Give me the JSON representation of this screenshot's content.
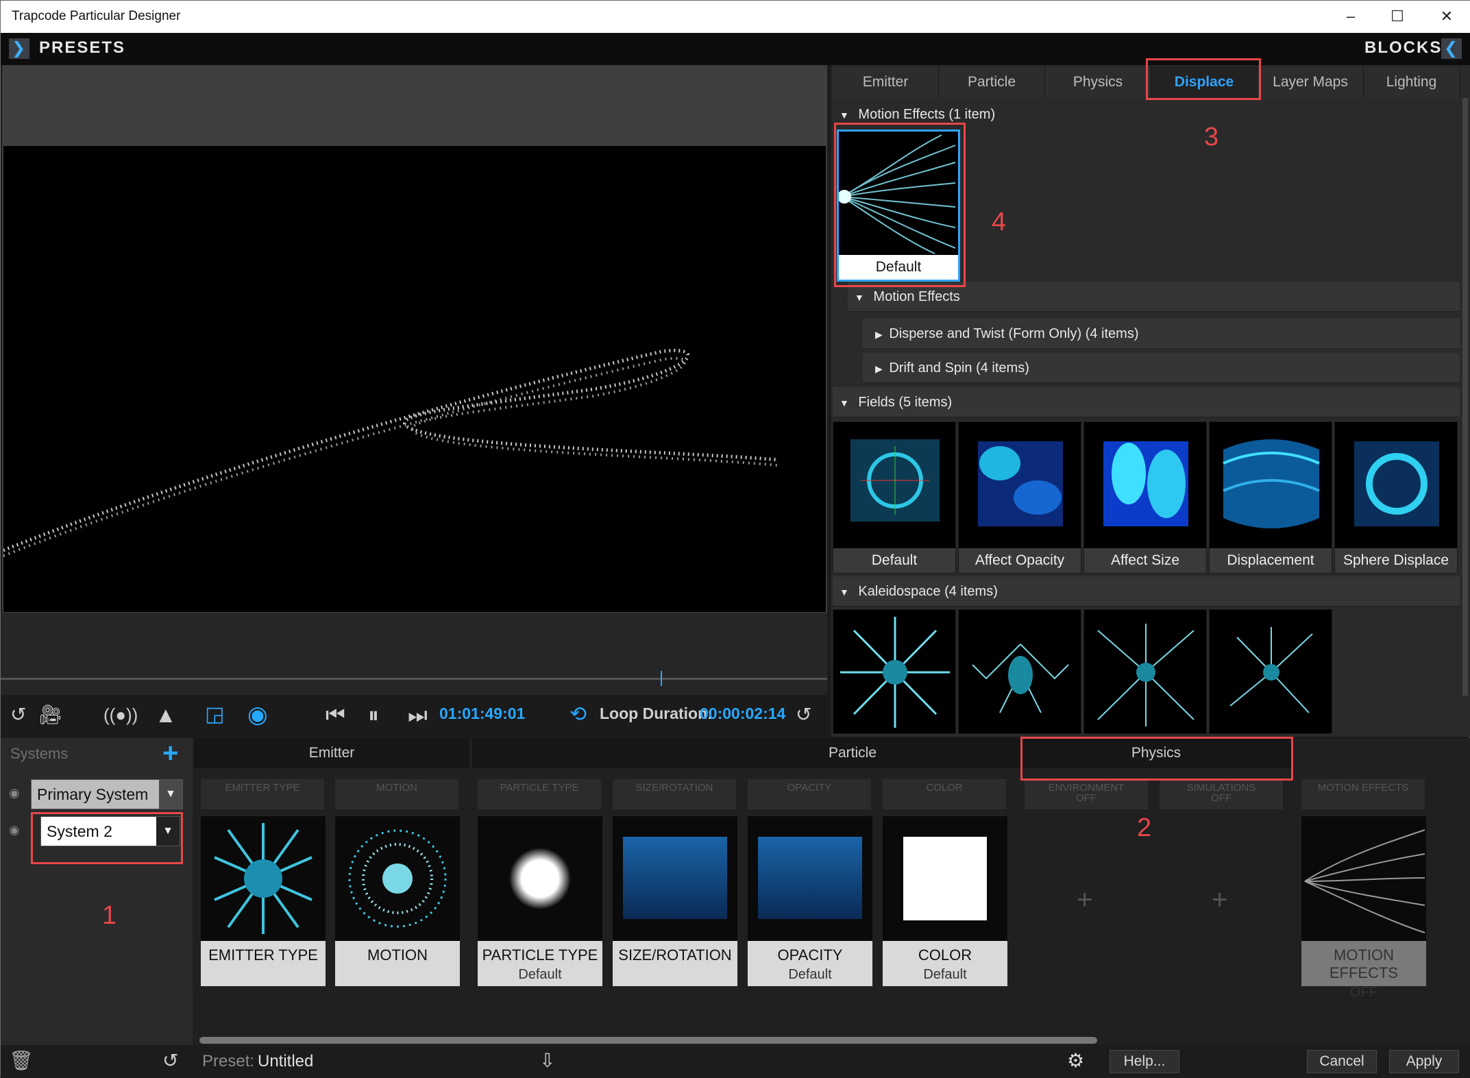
{
  "window": {
    "title": "Trapcode Particular Designer",
    "minimize": "–",
    "maximize": "☐",
    "close": "✕"
  },
  "topbar": {
    "left_label": "PRESETS",
    "right_label": "BLOCKS",
    "left_arrow": "❯",
    "right_arrow": "❮"
  },
  "transport": {
    "timecode": "01:01:49:01",
    "loop_label": "Loop Duration:",
    "loop_value": "00:00:02:14"
  },
  "tabs": [
    "Emitter",
    "Particle",
    "Physics",
    "Displace",
    "Layer Maps",
    "Lighting"
  ],
  "active_tab": "Displace",
  "library": {
    "motion_effects_header": "Motion Effects (1 item)",
    "motion_default": "Default",
    "motion_sub_header": "Motion Effects",
    "disperse": "Disperse and Twist (Form Only) (4 items)",
    "drift": "Drift and Spin (4 items)",
    "fields_header": "Fields (5 items)",
    "fields": [
      "Default",
      "Affect Opacity",
      "Affect Size",
      "Displacement",
      "Sphere Displace"
    ],
    "kaleido_header": "Kaleidospace (4 items)"
  },
  "systems": {
    "label": "Systems",
    "plus": "+",
    "items": [
      "Primary System",
      "System 2"
    ]
  },
  "sections": {
    "emitter": "Emitter",
    "particle": "Particle",
    "physics": "Physics"
  },
  "block_labels": {
    "emitter_type": "EMITTER TYPE",
    "motion": "MOTION",
    "particle_type": "PARTICLE TYPE",
    "size_rotation": "SIZE/ROTATION",
    "opacity": "OPACITY",
    "color": "COLOR",
    "environment": "ENVIRONMENT",
    "environment_state": "OFF",
    "simulations": "SIMULATIONS",
    "simulations_state": "OFF",
    "motion_effects": "MOTION EFFECTS"
  },
  "cards": {
    "emitter_type": {
      "title": "EMITTER TYPE"
    },
    "motion": {
      "title": "MOTION"
    },
    "particle_type": {
      "title": "PARTICLE TYPE",
      "sub": "Default"
    },
    "size_rotation": {
      "title": "SIZE/ROTATION"
    },
    "opacity": {
      "title": "OPACITY",
      "sub": "Default"
    },
    "color": {
      "title": "COLOR",
      "sub": "Default"
    },
    "motion_effects": {
      "title": "MOTION EFFECTS",
      "sub": "OFF"
    }
  },
  "status": {
    "preset_label": "Preset:",
    "preset_value": "Untitled",
    "help": "Help...",
    "cancel": "Cancel",
    "apply": "Apply"
  },
  "annotations": {
    "n1": "1",
    "n2": "2",
    "n3": "3",
    "n4": "4"
  },
  "colors": {
    "accent": "#27a8ff",
    "annotation": "#e8474a"
  }
}
